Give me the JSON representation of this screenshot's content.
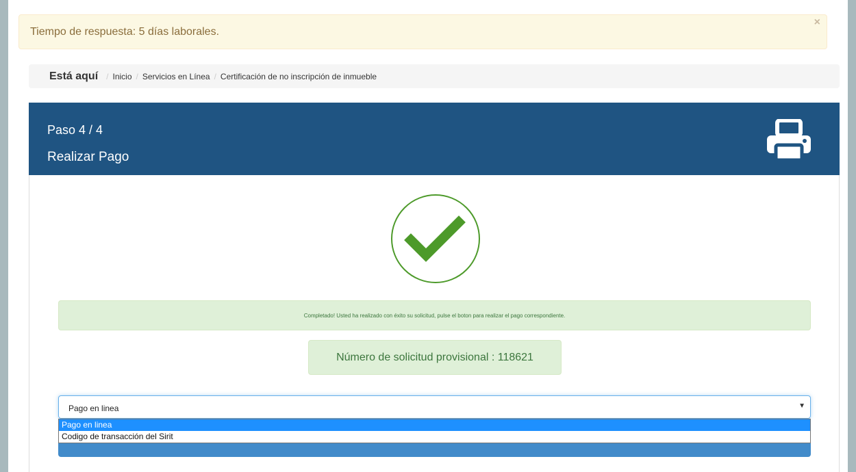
{
  "alert": {
    "message": "Tiempo de respuesta: 5 días laborales.",
    "close": "×"
  },
  "breadcrumb": {
    "here": "Está aquí",
    "items": [
      "Inicio",
      "Servicios en Línea",
      "Certificación de no inscripción de inmueble"
    ]
  },
  "panel": {
    "step": "Paso 4 / 4",
    "title": "Realizar Pago",
    "header_color": "#1f5482",
    "print_icon": "printer-icon"
  },
  "success": {
    "check_icon": "check-circle-icon",
    "check_color": "#4d9a2a",
    "message": "Completado! Usted ha realizado con éxito su solicitud, pulse el boton para realizar el pago correspondiente.",
    "number": "Número de solicitud provisional : 118621"
  },
  "payment": {
    "selected": "Pago en linea",
    "options": [
      "Pago en linea",
      "Codigo de transacción del Sirit"
    ],
    "button_visible": "pago",
    "button_color": "#428bca"
  }
}
